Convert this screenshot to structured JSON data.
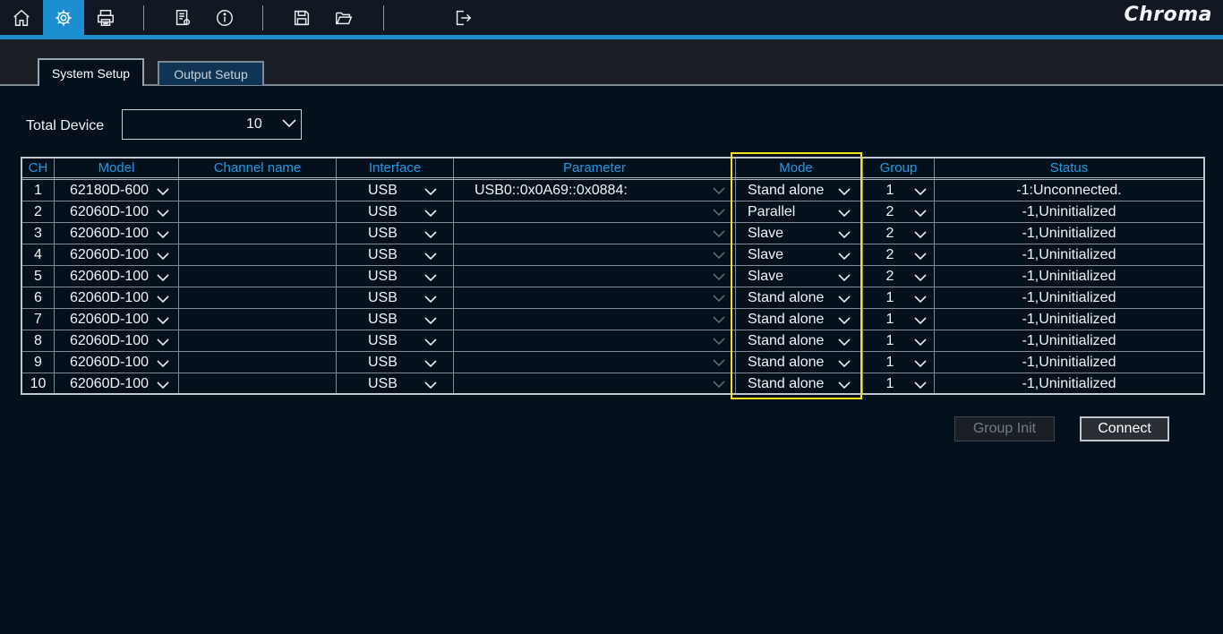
{
  "app": {
    "brand": "Chroma",
    "accent_color": "#1d8ed0",
    "highlight_color": "#f2e01a"
  },
  "toolbar": {
    "buttons": [
      {
        "icon": "home-icon",
        "active": false
      },
      {
        "icon": "gear-icon",
        "active": true
      },
      {
        "icon": "printer-icon",
        "active": false
      },
      {
        "icon": "report-icon",
        "active": false
      },
      {
        "icon": "info-icon",
        "active": false
      },
      {
        "icon": "save-icon",
        "active": false
      },
      {
        "icon": "open-folder-icon",
        "active": false
      },
      {
        "icon": "exit-icon",
        "active": false
      }
    ]
  },
  "tabs": [
    {
      "label": "System Setup",
      "active": true
    },
    {
      "label": "Output Setup",
      "active": false
    }
  ],
  "total_device": {
    "label": "Total Device",
    "value": "10"
  },
  "table": {
    "headers": {
      "ch": "CH",
      "model": "Model",
      "channel_name": "Channel name",
      "interface": "Interface",
      "parameter": "Parameter",
      "mode": "Mode",
      "group": "Group",
      "status": "Status"
    },
    "rows": [
      {
        "ch": "1",
        "model": "62180D-600",
        "channel_name": "",
        "interface": "USB",
        "parameter": "USB0::0x0A69::0x0884:",
        "mode": "Stand alone",
        "group": "1",
        "status": "-1:Unconnected."
      },
      {
        "ch": "2",
        "model": "62060D-100",
        "channel_name": "",
        "interface": "USB",
        "parameter": "",
        "mode": "Parallel",
        "group": "2",
        "status": "-1,Uninitialized"
      },
      {
        "ch": "3",
        "model": "62060D-100",
        "channel_name": "",
        "interface": "USB",
        "parameter": "",
        "mode": "Slave",
        "group": "2",
        "status": "-1,Uninitialized"
      },
      {
        "ch": "4",
        "model": "62060D-100",
        "channel_name": "",
        "interface": "USB",
        "parameter": "",
        "mode": "Slave",
        "group": "2",
        "status": "-1,Uninitialized"
      },
      {
        "ch": "5",
        "model": "62060D-100",
        "channel_name": "",
        "interface": "USB",
        "parameter": "",
        "mode": "Slave",
        "group": "2",
        "status": "-1,Uninitialized"
      },
      {
        "ch": "6",
        "model": "62060D-100",
        "channel_name": "",
        "interface": "USB",
        "parameter": "",
        "mode": "Stand alone",
        "group": "1",
        "status": "-1,Uninitialized"
      },
      {
        "ch": "7",
        "model": "62060D-100",
        "channel_name": "",
        "interface": "USB",
        "parameter": "",
        "mode": "Stand alone",
        "group": "1",
        "status": "-1,Uninitialized"
      },
      {
        "ch": "8",
        "model": "62060D-100",
        "channel_name": "",
        "interface": "USB",
        "parameter": "",
        "mode": "Stand alone",
        "group": "1",
        "status": "-1,Uninitialized"
      },
      {
        "ch": "9",
        "model": "62060D-100",
        "channel_name": "",
        "interface": "USB",
        "parameter": "",
        "mode": "Stand alone",
        "group": "1",
        "status": "-1,Uninitialized"
      },
      {
        "ch": "10",
        "model": "62060D-100",
        "channel_name": "",
        "interface": "USB",
        "parameter": "",
        "mode": "Stand alone",
        "group": "1",
        "status": "-1,Uninitialized"
      }
    ]
  },
  "actions": {
    "group_init_label": "Group Init",
    "group_init_enabled": false,
    "connect_label": "Connect"
  }
}
